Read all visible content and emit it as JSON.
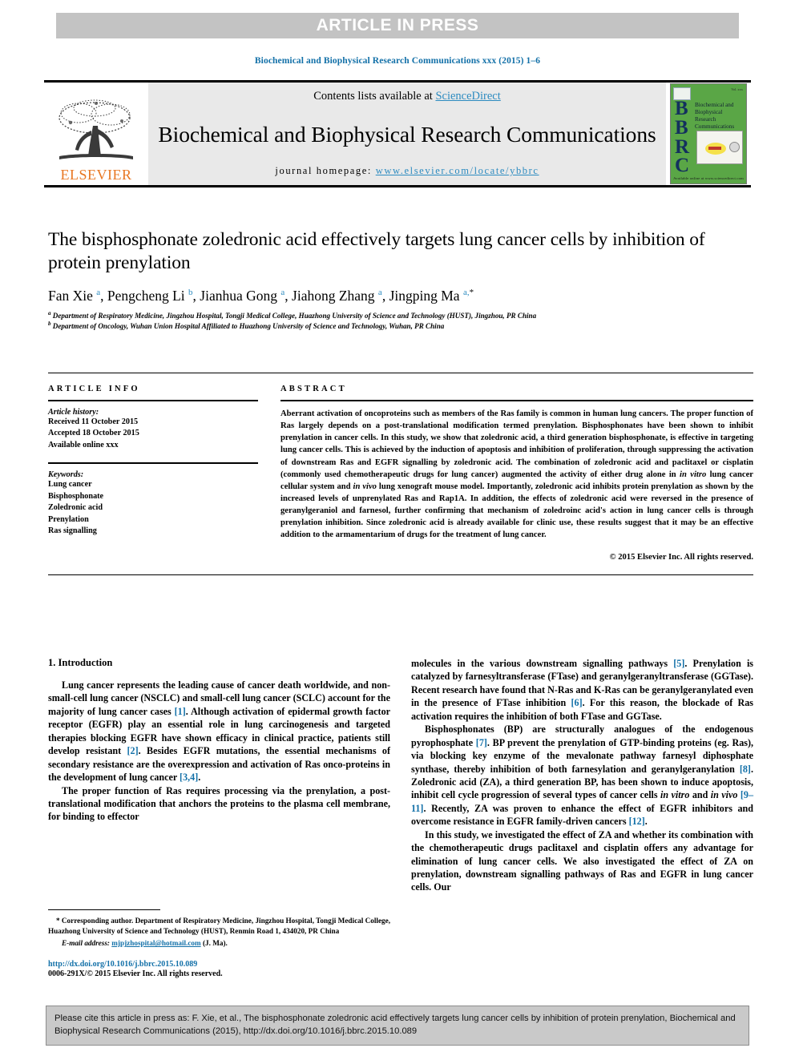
{
  "banner": {
    "label": "ARTICLE IN PRESS"
  },
  "running_head": "Biochemical and Biophysical Research Communications xxx (2015) 1–6",
  "masthead": {
    "publisher_name": "ELSEVIER",
    "contents_prefix": "Contents lists available at ",
    "contents_link": "ScienceDirect",
    "journal_title": "Biochemical and Biophysical Research Communications",
    "homepage_prefix": "journal homepage: ",
    "homepage_url": "www.elsevier.com/locate/ybbrc",
    "cover": {
      "letters": "B\nB\nR\nC",
      "title_lines": "Biochemical and Biophysical Research Communications",
      "corner_label": "ELSEVIER",
      "top_right_label": "Vol. xxx",
      "footer_label": "Available online at www.sciencedirect.com"
    }
  },
  "article": {
    "title": "The bisphosphonate zoledronic acid effectively targets lung cancer cells by inhibition of protein prenylation",
    "authors_html": "Fan Xie <sup class=\"aff-mark\">a</sup>, Pengcheng Li <sup class=\"aff-mark\">b</sup>, Jianhua Gong <sup class=\"aff-mark\">a</sup>, Jiahong Zhang <sup class=\"aff-mark\">a</sup>, Jingping Ma <sup class=\"aff-mark\">a,</sup><sup class=\"aff-mark blk\">*</sup>",
    "affiliation_a": "Department of Respiratory Medicine, Jingzhou Hospital, Tongji Medical College, Huazhong University of Science and Technology (HUST), Jingzhou, PR China",
    "affiliation_b": "Department of Oncology, Wuhan Union Hospital Affiliated to Huazhong University of Science and Technology, Wuhan, PR China"
  },
  "article_info": {
    "heading": "ARTICLE INFO",
    "history_label": "Article history:",
    "received": "Received 11 October 2015",
    "accepted": "Accepted 18 October 2015",
    "available": "Available online xxx",
    "keywords_label": "Keywords:",
    "keywords": [
      "Lung cancer",
      "Bisphosphonate",
      "Zoledronic acid",
      "Prenylation",
      "Ras signalling"
    ]
  },
  "abstract": {
    "heading": "ABSTRACT",
    "body_html": "Aberrant activation of oncoproteins such as members of the Ras family is common in human lung cancers. The proper function of Ras largely depends on a post-translational modification termed prenylation. Bisphosphonates have been shown to inhibit prenylation in cancer cells. In this study, we show that zoledronic acid, a third generation bisphosphonate, is effective in targeting lung cancer cells. This is achieved by the induction of apoptosis and inhibition of proliferation, through suppressing the activation of downstream Ras and EGFR signalling by zoledronic acid. The combination of zoledronic acid and paclitaxel or cisplatin (commonly used chemotherapeutic drugs for lung cancer) augmented the activity of either drug alone in <i>in vitro</i> lung cancer cellular system and <i>in vivo</i> lung xenograft mouse model. Importantly, zoledronic acid inhibits protein prenylation as shown by the increased levels of unprenylated Ras and Rap1A. In addition, the effects of zoledronic acid were reversed in the presence of geranylgeraniol and farnesol, further confirming that mechanism of zoledroinc acid's action in lung cancer cells is through prenylation inhibition. Since zoledronic acid is already available for clinic use, these results suggest that it may be an effective addition to the armamentarium of drugs for the treatment of lung cancer.",
    "copyright": "© 2015 Elsevier Inc. All rights reserved."
  },
  "body": {
    "section_title": "1.  Introduction",
    "left_paragraphs_html": [
      "Lung cancer represents the leading cause of cancer death worldwide, and non-small-cell lung cancer (NSCLC) and small-cell lung cancer (SCLC) account for the majority of lung cancer cases <span class=\"ref\">[1]</span>. Although activation of epidermal growth factor receptor (EGFR) play an essential role in lung carcinogenesis and targeted therapies blocking EGFR have shown efficacy in clinical practice, patients still develop resistant <span class=\"ref\">[2]</span>. Besides EGFR mutations, the essential mechanisms of secondary resistance are the overexpression and activation of Ras onco-proteins in the development of lung cancer <span class=\"ref\">[3,4]</span>.",
      "The proper function of Ras requires processing via the prenylation, a post-translational modification that anchors the proteins to the plasma cell membrane, for binding to effector"
    ],
    "right_paragraphs_html": [
      "molecules in the various downstream signalling pathways <span class=\"ref\">[5]</span>. Prenylation is catalyzed by farnesyltransferase (FTase) and geranylgeranyltransferase (GGTase). Recent research have found that N-Ras and K-Ras can be geranylgeranylated even in the presence of FTase inhibition <span class=\"ref\">[6]</span>. For this reason, the blockade of Ras activation requires the inhibition of both FTase and GGTase.",
      "Bisphosphonates (BP) are structurally analogues of the endogenous pyrophosphate <span class=\"ref\">[7]</span>. BP prevent the prenylation of GTP-binding proteins (eg. Ras), via blocking key enzyme of the mevalonate pathway farnesyl diphosphate synthase, thereby inhibition of both farnesylation and geranylgeranylation <span class=\"ref\">[8]</span>. Zoledronic acid (ZA), a third generation BP, has been shown to induce apoptosis, inhibit cell cycle progression of several types of cancer cells <i>in vitro</i> and <i>in vivo</i> <span class=\"ref\">[9–11]</span>. Recently, ZA was proven to enhance the effect of EGFR inhibitors and overcome resistance in EGFR family-driven cancers <span class=\"ref\">[12]</span>.",
      "In this study, we investigated the effect of ZA and whether its combination with the chemotherapeutic drugs paclitaxel and cisplatin offers any advantage for elimination of lung cancer cells. We also investigated the effect of ZA on prenylation, downstream signalling pathways of Ras and EGFR in lung cancer cells. Our"
    ]
  },
  "footnote": {
    "corresponding_html": "<b>*</b> Corresponding author. Department of Respiratory Medicine, Jingzhou Hospital, Tongji Medical College, Huazhong University of Science and Technology (HUST), Renmin Road 1, 434020, PR China",
    "email_label": "E-mail address:",
    "email": "mjpjzhospital@hotmail.com",
    "email_suffix": "(J. Ma).",
    "doi": "http://dx.doi.org/10.1016/j.bbrc.2015.10.089",
    "issn": "0006-291X/© 2015 Elsevier Inc. All rights reserved."
  },
  "citation_box": {
    "text": "Please cite this article in press as: F. Xie, et al., The bisphosphonate zoledronic acid effectively targets lung cancer cells by inhibition of protein prenylation, Biochemical and Biophysical Research Communications (2015), http://dx.doi.org/10.1016/j.bbrc.2015.10.089"
  },
  "colors": {
    "link_blue": "#2d8bc0",
    "ref_blue": "#1270a8",
    "elsevier_orange": "#e87722",
    "banner_gray": "#c3c3c3",
    "masthead_gray": "#e9e9e9",
    "cover_green": "#5aa646",
    "cite_box_gray": "#c9c9c9"
  }
}
